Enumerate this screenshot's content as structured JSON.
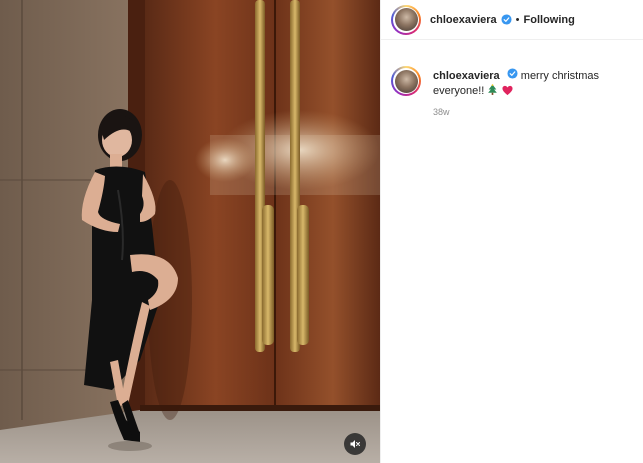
{
  "post": {
    "username": "chloexaviera",
    "separator": "•",
    "follow_status": "Following",
    "caption": "merry christmas everyone!!",
    "caption_emojis": [
      "tree-icon",
      "heart-icon"
    ],
    "timestamp": "38w",
    "verified": true,
    "mute_icon": "muted-speaker-icon",
    "colors": {
      "verified_blue": "#3897f0",
      "heart_red": "#e0245e",
      "tree_green": "#2e8b57",
      "text": "#262626",
      "muted_text": "#8e8e8e"
    }
  }
}
